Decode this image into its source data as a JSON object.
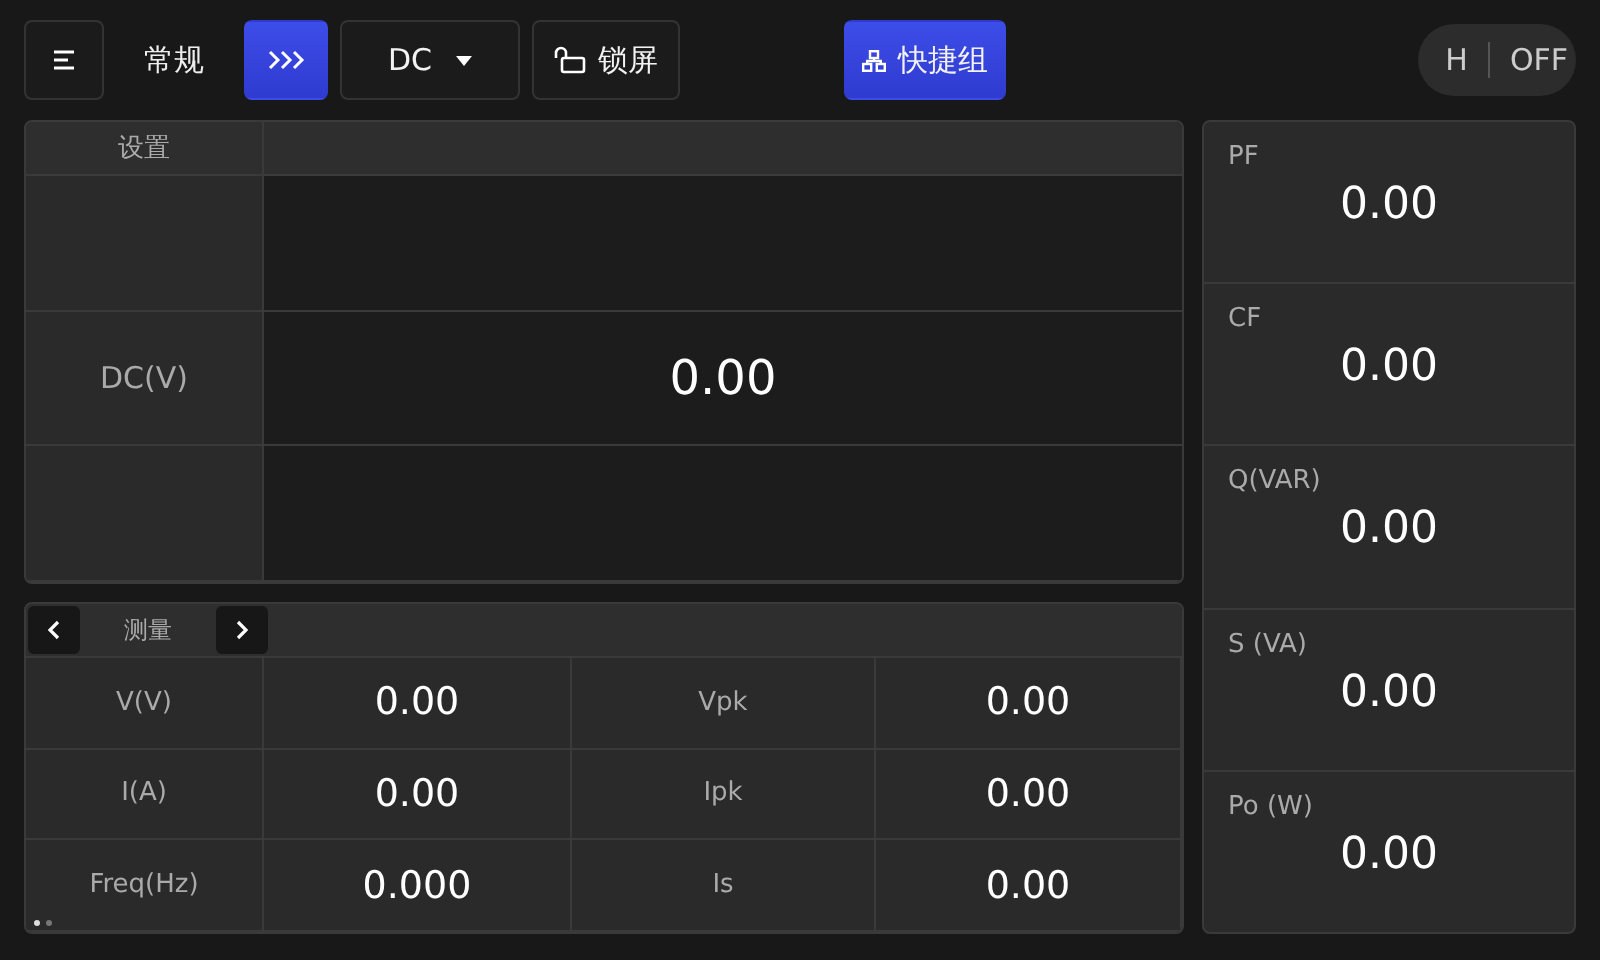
{
  "toolbar": {
    "mode_label": "常规",
    "active_button": {
      "highlighted": true
    },
    "source_dropdown": {
      "value": "DC"
    },
    "lock_button": {
      "label": "锁屏"
    },
    "quick_group_button": {
      "label": "快捷组",
      "highlighted": true
    },
    "toggle": {
      "left": "H",
      "right": "OFF"
    }
  },
  "settings": {
    "header": "设置",
    "rows": [
      {
        "label": "",
        "value": ""
      },
      {
        "label": "DC(V)",
        "value": "0.00"
      },
      {
        "label": "",
        "value": ""
      }
    ]
  },
  "measure": {
    "header": "测量",
    "rows": [
      {
        "cells": [
          "V(V)",
          "0.00",
          "Vpk",
          "0.00"
        ]
      },
      {
        "cells": [
          "I(A)",
          "0.00",
          "Ipk",
          "0.00"
        ]
      },
      {
        "cells": [
          "Freq(Hz)",
          "0.000",
          "Is",
          "0.00"
        ]
      }
    ],
    "pages": [
      {
        "selected": true
      },
      {
        "selected": false
      }
    ]
  },
  "readings": [
    {
      "label": "PF",
      "value": "0.00"
    },
    {
      "label": "CF",
      "value": "0.00"
    },
    {
      "label": "Q(VAR)",
      "value": "0.00"
    },
    {
      "label": "S (VA)",
      "value": "0.00"
    },
    {
      "label": "Po (W)",
      "value": "0.00"
    }
  ]
}
